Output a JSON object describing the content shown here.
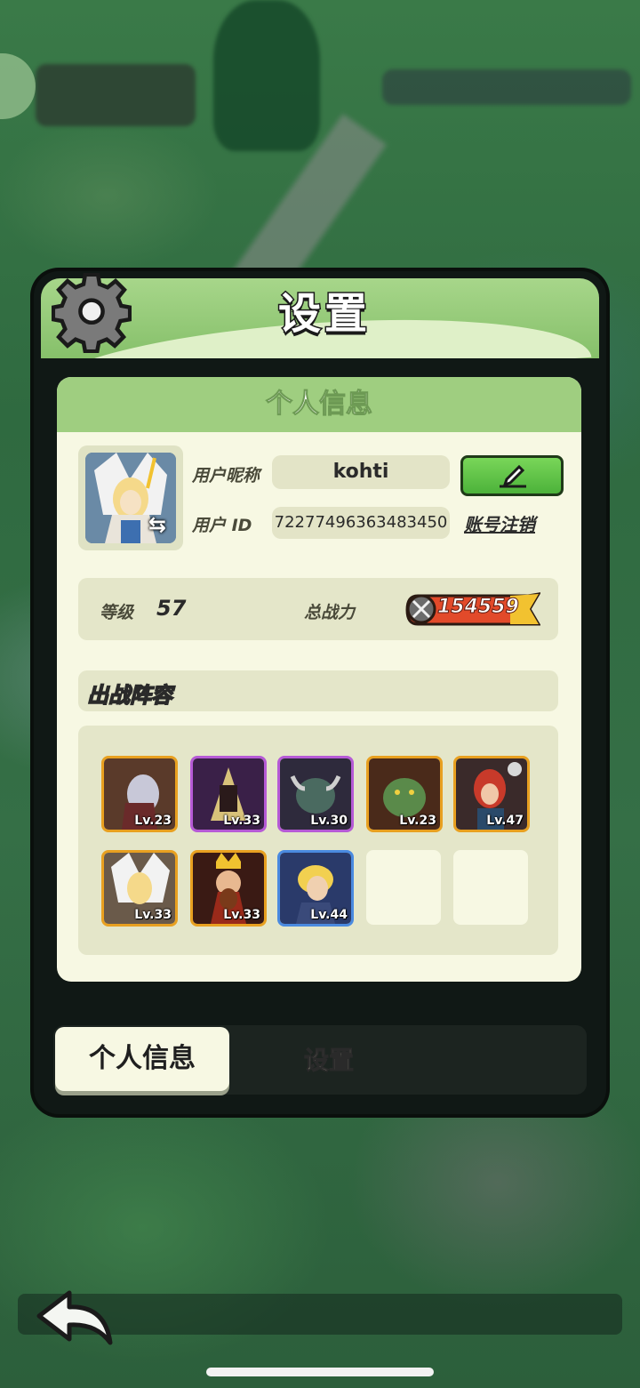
{
  "header": {
    "title": "设置"
  },
  "profile": {
    "section_title": "个人信息",
    "nickname_label": "用户昵称",
    "nickname_value": "kohti",
    "user_id_label": "用户 ID",
    "user_id_value": "72277496363483450",
    "delete_account_label": "账号注销",
    "level_label": "等级",
    "level_value": "57",
    "power_label": "总战力",
    "power_value": "154559"
  },
  "lineup": {
    "title": "出战阵容",
    "heroes": [
      {
        "level": "Lv.23",
        "rarity": "orange"
      },
      {
        "level": "Lv.33",
        "rarity": "purple"
      },
      {
        "level": "Lv.30",
        "rarity": "purple"
      },
      {
        "level": "Lv.23",
        "rarity": "orange"
      },
      {
        "level": "Lv.47",
        "rarity": "orange"
      },
      {
        "level": "Lv.33",
        "rarity": "orange"
      },
      {
        "level": "Lv.33",
        "rarity": "orange"
      },
      {
        "level": "Lv.44",
        "rarity": "blue"
      }
    ],
    "empty_slots": 2
  },
  "tabs": [
    {
      "label": "个人信息",
      "active": true
    },
    {
      "label": "设置",
      "active": false
    }
  ],
  "colors": {
    "header_green": "#9fce80",
    "panel_cream": "#f7f8e3",
    "edit_green": "#4cb23a"
  }
}
